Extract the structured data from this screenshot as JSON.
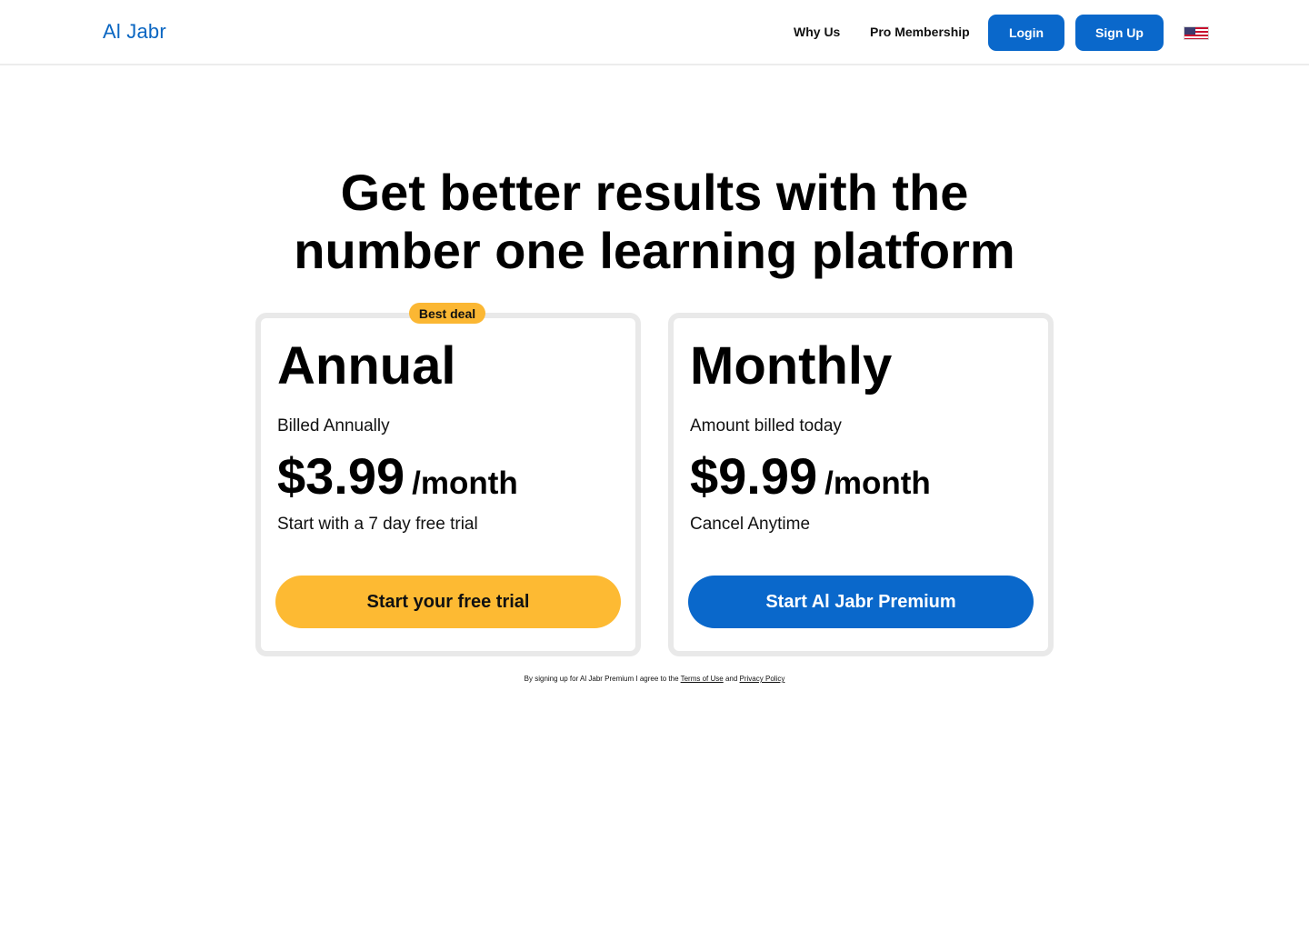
{
  "header": {
    "logo": "Al Jabr",
    "nav": {
      "why_us": "Why Us",
      "pro_membership": "Pro Membership"
    },
    "login_label": "Login",
    "signup_label": "Sign Up",
    "language_icon": "us-flag-icon"
  },
  "hero": {
    "headline_line1": "Get better results with the",
    "headline_line2": "number one learning platform"
  },
  "plans": {
    "annual": {
      "badge": "Best deal",
      "title": "Annual",
      "billing": "Billed Annually",
      "price": "$3.99",
      "period": "/month",
      "note": "Start with a 7 day free trial",
      "cta": "Start your free trial"
    },
    "monthly": {
      "title": "Monthly",
      "billing": "Amount billed today",
      "price": "$9.99",
      "period": "/month",
      "note": "Cancel Anytime",
      "cta": "Start Al Jabr Premium"
    }
  },
  "footer": {
    "terms_prefix": "By signing up for Al Jabr Premium I agree to the ",
    "terms_link": "Terms of Use",
    "terms_and": " and ",
    "privacy_link": "Privacy Policy"
  },
  "colors": {
    "brand_blue": "#0a68cb",
    "accent_yellow": "#fdba33",
    "card_border": "#e9e9e9"
  }
}
